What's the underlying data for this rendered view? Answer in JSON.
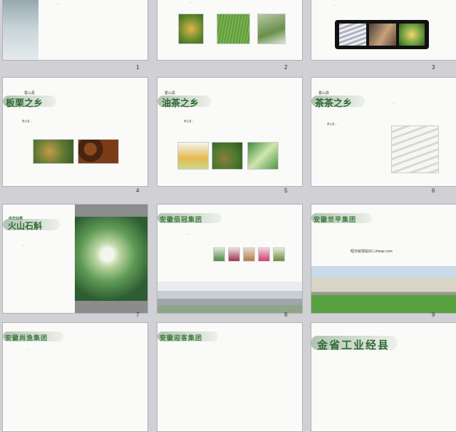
{
  "slides": [
    {
      "number": "1",
      "body": "…"
    },
    {
      "number": "2",
      "body": "…"
    },
    {
      "number": "3",
      "body": "…"
    },
    {
      "number": "4",
      "tag": "霍山县",
      "heading": "板栗之乡",
      "body": "霍山县…"
    },
    {
      "number": "5",
      "tag": "霍山县",
      "heading": "油茶之乡",
      "body": "霍山县…"
    },
    {
      "number": "6",
      "tag": "霍山县",
      "heading": "茶茶之乡",
      "body": "霍山县…",
      "side_text": "…"
    },
    {
      "number": "7",
      "tag": "中华仙草",
      "heading": "火山石斛",
      "body": "…"
    },
    {
      "number": "8",
      "heading": "安徽佰冠集团",
      "body": "…"
    },
    {
      "number": "9",
      "heading": "安徽世平集团",
      "caption": "昭日就观帖SC.chinaz.com"
    },
    {
      "number": "",
      "heading": "安徽尚渔集团",
      "body": "…"
    },
    {
      "number": "",
      "heading": "安徽迎客集团"
    },
    {
      "number": "",
      "heading": "金省工业经县"
    }
  ]
}
